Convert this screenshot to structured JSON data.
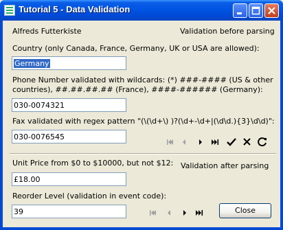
{
  "window": {
    "title": "Tutorial 5 - Data Validation"
  },
  "company": "Alfreds Futterkiste",
  "validation_before": "Validation before parsing",
  "validation_after": "Validation after parsing",
  "country": {
    "label": "Country (only Canada, France, Germany, UK or USA are allowed):",
    "value": "Germany"
  },
  "phone": {
    "label_line1": "Phone Number validated with wildcards:  (*) ###-#### (US & other",
    "label_line2": "countries), ##.##.##.## (France), ####-###### (Germany):",
    "value": "030-0074321"
  },
  "fax": {
    "label": "Fax validated with regex pattern \"(\\(\\d+\\) )?(\\d+-\\d+|(\\d\\d.){3}\\d\\d)\":",
    "value": "030-0076545"
  },
  "unit_price": {
    "label": "Unit Price from $0 to  $10000, but not $12:",
    "value": "£18.00"
  },
  "reorder": {
    "label": "Reorder Level (validation in event code):",
    "value": "39"
  },
  "buttons": {
    "close_label": "Close"
  },
  "icons": {
    "nav_top": [
      "first-icon",
      "prev-icon",
      "next-icon",
      "last-icon",
      "check-icon",
      "cancel-icon",
      "refresh-icon"
    ],
    "nav_bottom": [
      "first-icon",
      "prev-icon",
      "next-icon",
      "last-icon"
    ]
  },
  "colors": {
    "title_bar": "#0054e3",
    "selection": "#316ac5",
    "window_bg": "#ece9d8"
  }
}
